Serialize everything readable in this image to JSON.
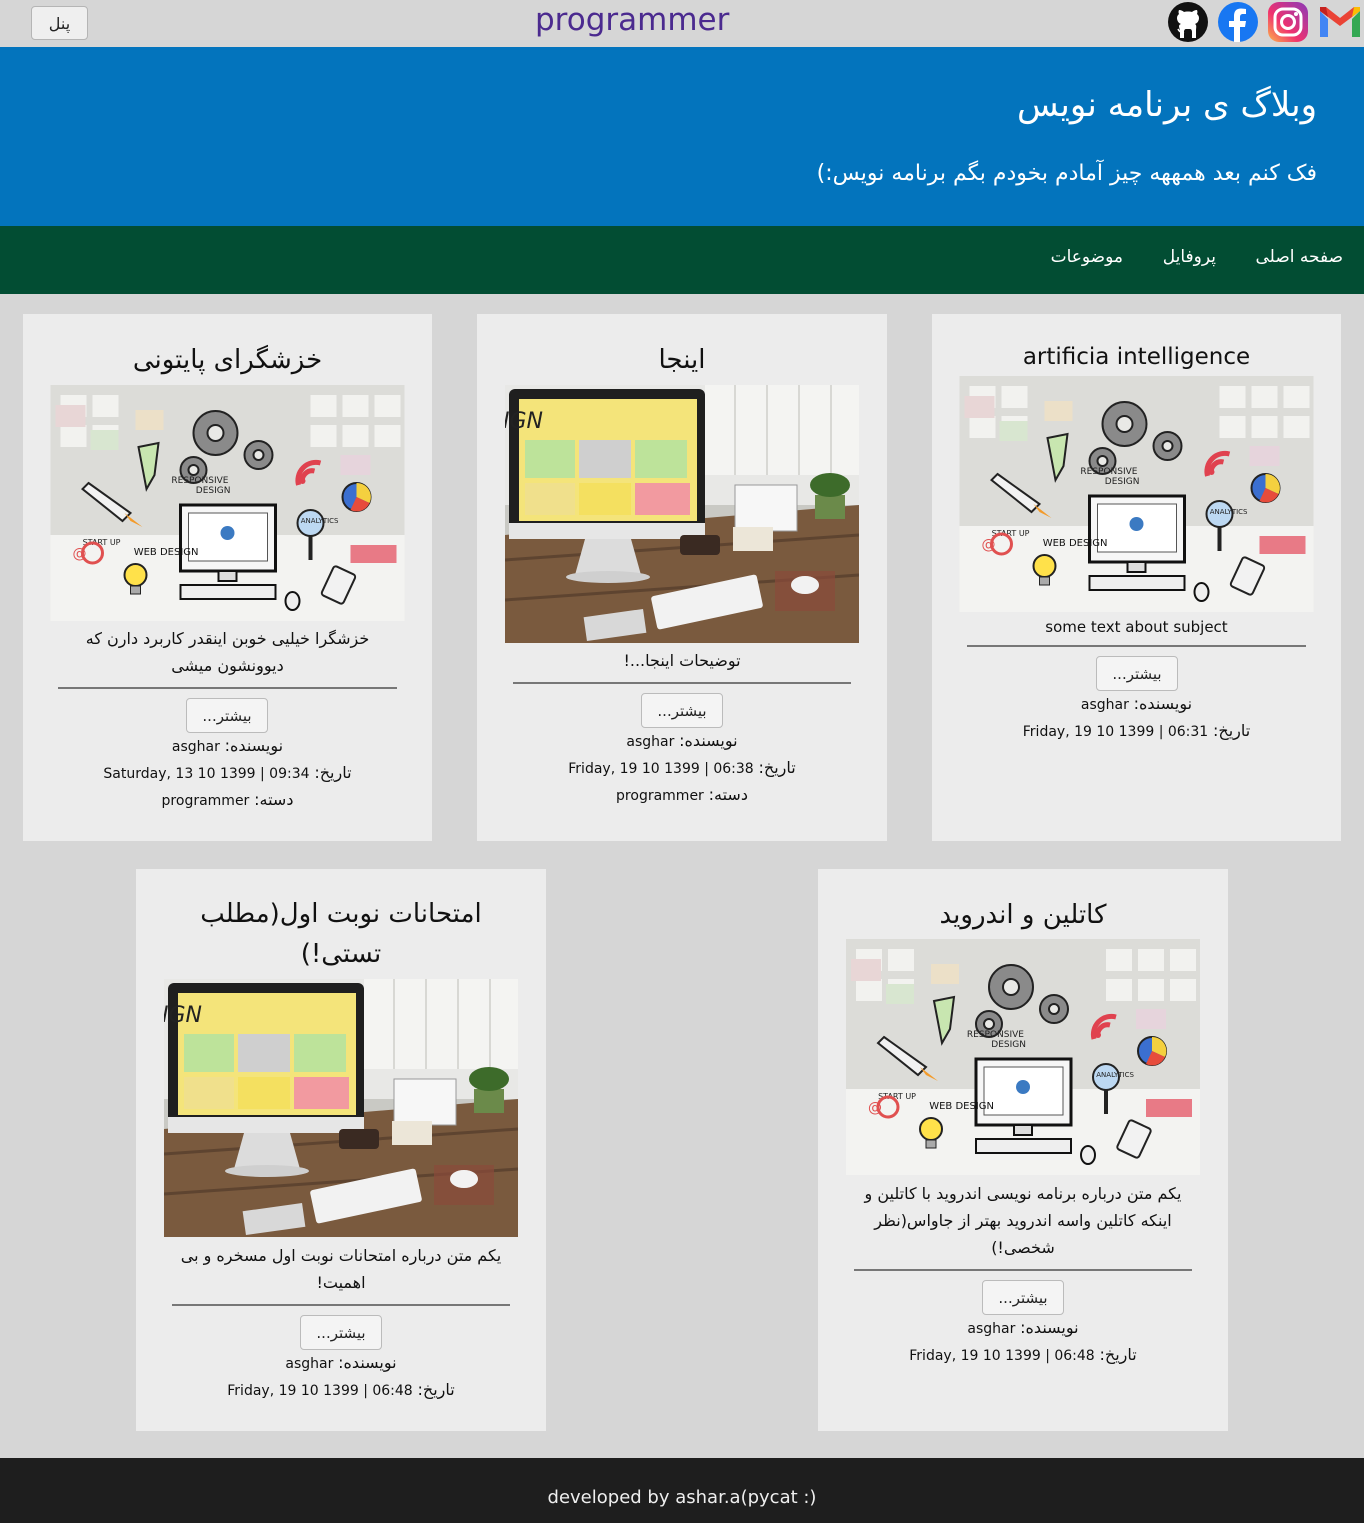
{
  "topbar": {
    "panel_label": "پنل",
    "brand": "programmer",
    "social": [
      {
        "icon": "github-icon",
        "color": "#111111"
      },
      {
        "icon": "facebook-icon",
        "color": "#1877f2"
      },
      {
        "icon": "instagram-icon",
        "color": "#e1306c"
      },
      {
        "icon": "gmail-icon",
        "color": "#ea4335"
      }
    ]
  },
  "hero": {
    "title": "وبلاگ ی برنامه نویس",
    "subtitle": "فک کنم بعد همههه چیز آمادم بخودم بگم برنامه نویس:)",
    "bg_color": "#0374bd"
  },
  "nav": {
    "items": [
      {
        "label": "صفحه اصلی"
      },
      {
        "label": "پروفایل"
      },
      {
        "label": "موضوعات"
      }
    ],
    "bg_color": "#024d33"
  },
  "labels": {
    "more": "بیشتر...",
    "author": "نویسنده:",
    "date": "تاریخ:",
    "category": "دسته:"
  },
  "posts": [
    {
      "title": "artificia intelligence",
      "image": "responsive-design-illustration",
      "description": "some text about subject",
      "author": "asghar",
      "date": "Friday, 19 10 1399 | 06:31"
    },
    {
      "title": "اینجا",
      "image": "web-design-desk-photo",
      "description": "توضیحات اینجا...!",
      "author": "asghar",
      "date": "Friday, 19 10 1399 | 06:38",
      "category": "programmer"
    },
    {
      "title": "خزشگرای پایتونی",
      "image": "responsive-design-illustration",
      "description": "خزشگرا خیلیی خوبن اینقدر کاربرد دارن که دیوونشون میشی",
      "author": "asghar",
      "date": "Saturday, 13 10 1399 | 09:34",
      "category": "programmer"
    },
    {
      "title": "کاتلین و اندروید",
      "image": "responsive-design-illustration",
      "description": "یکم متن درباره برنامه نویسی اندروید با کاتلین و اینکه کاتلین واسه اندروید بهتر از جاواس(نظر شخصی!)",
      "author": "asghar",
      "date": "Friday, 19 10 1399 | 06:48"
    },
    {
      "title": "امتحانات نوبت اول(مطلب تستی!)",
      "image": "web-design-desk-photo",
      "description": "یکم متن درباره امتحانات نوبت اول مسخره و بی اهمیت!",
      "author": "asghar",
      "date": "Friday, 19 10 1399 | 06:48"
    }
  ],
  "footer": {
    "text": "developed by ashar.a(pycat :)"
  }
}
